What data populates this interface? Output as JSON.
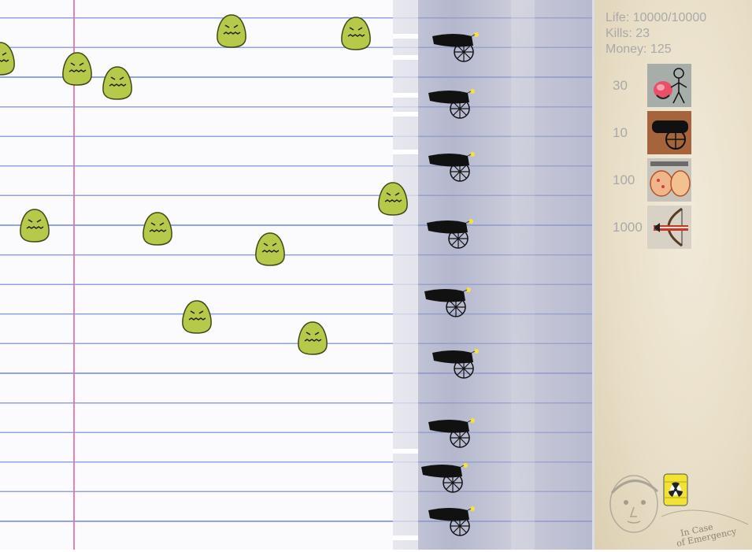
{
  "stats": {
    "life": "Life: 10000/10000",
    "kills": "Kills: 23",
    "money": "Money: 125"
  },
  "shop": [
    {
      "price": "30",
      "icon": "brain-stickman-icon"
    },
    {
      "price": "10",
      "icon": "cannon-icon"
    },
    {
      "price": "100",
      "icon": "fists-icon"
    },
    {
      "price": "1000",
      "icon": "bow-arrow-icon"
    }
  ],
  "emergency": {
    "label_line1": "In Case",
    "label_line2": "of Emergency",
    "icon": "radioactive-barrel-icon"
  },
  "colors": {
    "enemy_fill": "#b6c94a",
    "enemy_stroke": "#3f4a18",
    "cannon": "#111111",
    "fuse": "#f5e23a",
    "margin_line": "#e86aa8",
    "ruled_line": "#8fa3e8",
    "stat_text": "#a9a9a9"
  }
}
